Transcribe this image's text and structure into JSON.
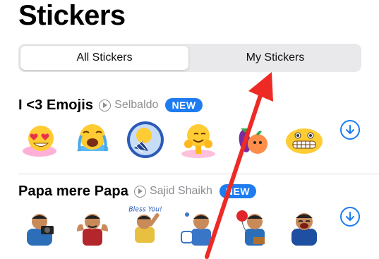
{
  "page": {
    "title": "Stickers"
  },
  "segmented": {
    "all_label": "All Stickers",
    "mine_label": "My Stickers",
    "selected": "All Stickers"
  },
  "packs": [
    {
      "name": "I <3 Emojis",
      "author": "Selbaldo",
      "badge": "NEW",
      "download_icon": "arrow-down-circle-icon",
      "stickers": [
        "heart-eyes-emoji-sticker",
        "crying-emoji-sticker",
        "tennis-emoji-sticker",
        "hugging-emoji-sticker",
        "eggplant-peach-sticker",
        "grimacing-emoji-sticker"
      ]
    },
    {
      "name": "Papa mere Papa",
      "author": "Sajid Shaikh",
      "badge": "NEW",
      "download_icon": "arrow-down-circle-icon",
      "sticker_text": "Bless You!",
      "stickers": [
        "papa-camera-sticker",
        "papa-flexing-sticker",
        "papa-bless-you-sticker",
        "papa-baby-sticker",
        "papa-balloon-sticker",
        "papa-laughing-sticker"
      ]
    }
  ],
  "annotation": {
    "type": "red-arrow",
    "color": "#ee2a24",
    "points_to": "My Stickers"
  },
  "colors": {
    "accent": "#1e7cf0",
    "secondary_text": "#8e8e93",
    "segment_bg": "#e9e9eb"
  }
}
